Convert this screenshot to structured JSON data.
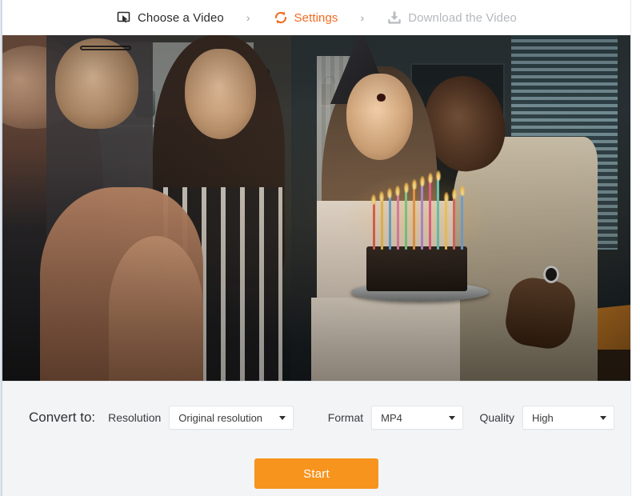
{
  "steps": [
    {
      "id": "choose-a-video",
      "label": "Choose a Video",
      "icon": "select-video-icon",
      "state": "done"
    },
    {
      "id": "settings",
      "label": "Settings",
      "icon": "refresh-icon",
      "state": "active"
    },
    {
      "id": "download-the-video",
      "label": "Download the Video",
      "icon": "download-icon",
      "state": "todo"
    }
  ],
  "separator": "›",
  "video": {
    "alt": "Group of friends celebrating a birthday with a candle-lit cake in a kitchen"
  },
  "settings": {
    "convert_to_label": "Convert to:",
    "fields": [
      {
        "id": "resolution",
        "label": "Resolution",
        "value": "Original resolution"
      },
      {
        "id": "format",
        "label": "Format",
        "value": "MP4"
      },
      {
        "id": "quality",
        "label": "Quality",
        "value": "High"
      }
    ],
    "start_label": "Start"
  },
  "colors": {
    "accent_orange": "#f26b21",
    "button_orange": "#f7941e",
    "panel_bg": "#f2f4f6",
    "text_dark": "#2b2b2b",
    "text_muted": "#b5b8bd"
  }
}
